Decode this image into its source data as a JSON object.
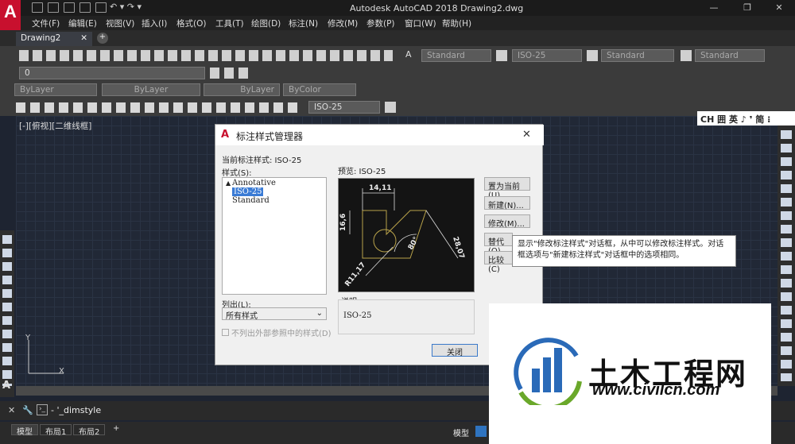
{
  "app": {
    "title": "Autodesk AutoCAD 2018    Drawing2.dwg",
    "logo": "A"
  },
  "menus": [
    "文件(F)",
    "编辑(E)",
    "视图(V)",
    "插入(I)",
    "格式(O)",
    "工具(T)",
    "绘图(D)",
    "标注(N)",
    "修改(M)",
    "参数(P)",
    "窗口(W)",
    "帮助(H)"
  ],
  "doc_tab": "Drawing2",
  "toolbar": {
    "text_style": "Standard",
    "dim_style": "ISO-25",
    "table_style": "Standard",
    "mleader_style": "Standard",
    "layer": "0",
    "color": "ByLayer",
    "linetype": "ByLayer",
    "lineweight": "ByLayer",
    "plotstyle": "ByColor",
    "dim_style2": "ISO-25"
  },
  "view_label": "[-][俯视][二维线框]",
  "ime": {
    "text": "CH 囲 英 ♪ ❜ 简 ⁝"
  },
  "dialog": {
    "title": "标注样式管理器",
    "current_label": "当前标注样式: ISO-25",
    "styles_label": "样式(S):",
    "styles": [
      "Annotative",
      "ISO-25",
      "Standard"
    ],
    "preview_label": "预览: ISO-25",
    "list_label": "列出(L):",
    "list_value": "所有样式",
    "checkbox_label": "不列出外部参照中的样式(D)",
    "desc_label": "说明",
    "desc_value": "ISO-25",
    "buttons": {
      "set_current": "置为当前(U)",
      "new": "新建(N)...",
      "modify": "修改(M)...",
      "override": "替代(O)",
      "compare": "比较(C)",
      "close": "关闭"
    },
    "preview_dims": {
      "top": "14,11",
      "left": "16,6",
      "right": "28,07",
      "angle": "80°",
      "radius": "R11,17"
    }
  },
  "tooltip": "显示\"修改标注样式\"对话框，从中可以修改标注样式。对话框选项与\"新建标注样式\"对话框中的选项相同。",
  "command": "'_dimstyle",
  "layout_tabs": [
    "模型",
    "布局1",
    "布局2",
    "+"
  ],
  "status_model": "模型",
  "watermark": {
    "title": "土木工程网",
    "url": "www.civilcn.com"
  },
  "colors": {
    "canvas": "#212836",
    "accent": "#c8102e",
    "ui_dark": "#2a2a2a"
  }
}
